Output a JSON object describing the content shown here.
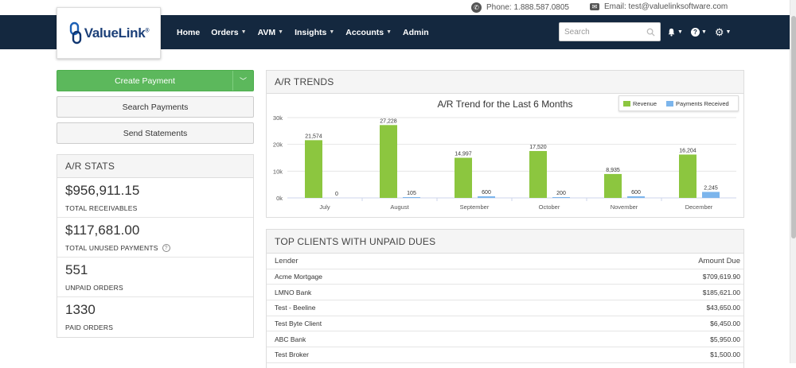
{
  "topbar": {
    "phone": "Phone: 1.888.587.0805",
    "email": "Email: test@valuelinksoftware.com",
    "phone_icon": "phone-icon",
    "email_icon": "envelope-icon"
  },
  "brand": {
    "name": "ValueLink",
    "mark": "®",
    "logo_icon": "chain-link-icon"
  },
  "nav": {
    "items": [
      {
        "label": "Home",
        "caret": false
      },
      {
        "label": "Orders",
        "caret": true
      },
      {
        "label": "AVM",
        "caret": true
      },
      {
        "label": "Insights",
        "caret": true
      },
      {
        "label": "Accounts",
        "caret": true
      },
      {
        "label": "Admin",
        "caret": false
      }
    ],
    "search_placeholder": "Search",
    "icons": [
      "bell-icon",
      "help-icon",
      "gear-icon"
    ]
  },
  "actions": {
    "create_payment": "Create Payment",
    "search_payments": "Search Payments",
    "send_statements": "Send Statements"
  },
  "ar_stats": {
    "title": "A/R STATS",
    "items": [
      {
        "value": "$956,911.15",
        "label": "TOTAL RECEIVABLES"
      },
      {
        "value": "$117,681.00",
        "label": "TOTAL UNUSED PAYMENTS"
      },
      {
        "value": "551",
        "label": "UNPAID ORDERS"
      },
      {
        "value": "1330",
        "label": "PAID ORDERS"
      }
    ]
  },
  "ar_trends": {
    "title": "A/R TRENDS"
  },
  "chart_data": {
    "type": "bar",
    "title": "A/R Trend for the Last 6 Months",
    "categories": [
      "July",
      "August",
      "September",
      "October",
      "November",
      "December"
    ],
    "series": [
      {
        "name": "Revenue",
        "color": "#8cc63f",
        "values": [
          21574,
          27228,
          14997,
          17520,
          8935,
          16204
        ]
      },
      {
        "name": "Payments Received",
        "color": "#7cb5ec",
        "values": [
          0,
          105,
          600,
          200,
          600,
          2245
        ]
      }
    ],
    "data_labels": [
      [
        "21,574",
        "27,228",
        "14,997",
        "17,520",
        "8,935",
        "16,204"
      ],
      [
        "0",
        "105",
        "600",
        "200",
        "600",
        "2,245"
      ]
    ],
    "y_ticks": [
      "0k",
      "10k",
      "20k",
      "30k"
    ],
    "ylim": [
      0,
      30000
    ],
    "legend": "top-right",
    "grid": true
  },
  "top_clients": {
    "title": "TOP CLIENTS WITH UNPAID DUES",
    "col_lender": "Lender",
    "col_amount": "Amount Due",
    "rows": [
      {
        "lender": "Acme Mortgage",
        "amount": "$709,619.90"
      },
      {
        "lender": "LMNO Bank",
        "amount": "$185,621.00"
      },
      {
        "lender": "Test - Beeline",
        "amount": "$43,650.00"
      },
      {
        "lender": "Test Byte Client",
        "amount": "$6,450.00"
      },
      {
        "lender": "ABC Bank",
        "amount": "$5,950.00"
      },
      {
        "lender": "Test Broker",
        "amount": "$1,500.00"
      }
    ]
  }
}
